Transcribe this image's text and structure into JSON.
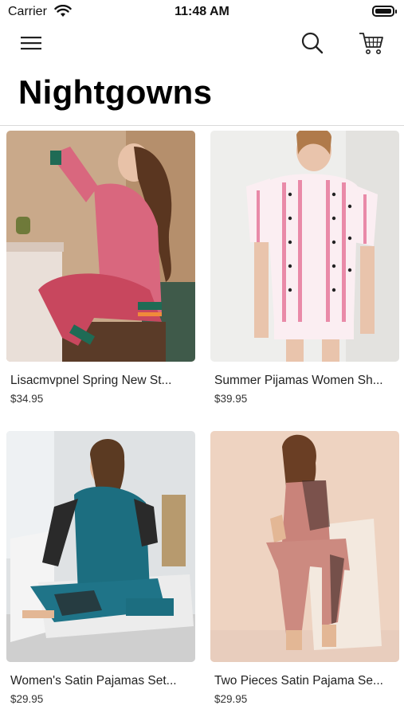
{
  "status_bar": {
    "carrier": "Carrier",
    "time": "11:48 AM"
  },
  "nav": {
    "menu_icon": "hamburger-menu-icon",
    "search_icon": "search-icon",
    "cart_icon": "cart-icon"
  },
  "page": {
    "title": "Nightgowns"
  },
  "products": [
    {
      "name": "Lisacmvpnel Spring New St...",
      "price": "$34.95",
      "image_desc": "pink printed satin pajamas"
    },
    {
      "name": "Summer Pijamas Women Sh...",
      "price": "$39.95",
      "image_desc": "white striped short pajamas"
    },
    {
      "name": "Women's Satin Pajamas Set...",
      "price": "$29.95",
      "image_desc": "teal satin robe set"
    },
    {
      "name": "Two Pieces Satin Pajama Se...",
      "price": "$29.95",
      "image_desc": "rose satin cami pajama"
    }
  ],
  "colors": {
    "accent": "#000000",
    "divider": "#d9d9d9"
  }
}
